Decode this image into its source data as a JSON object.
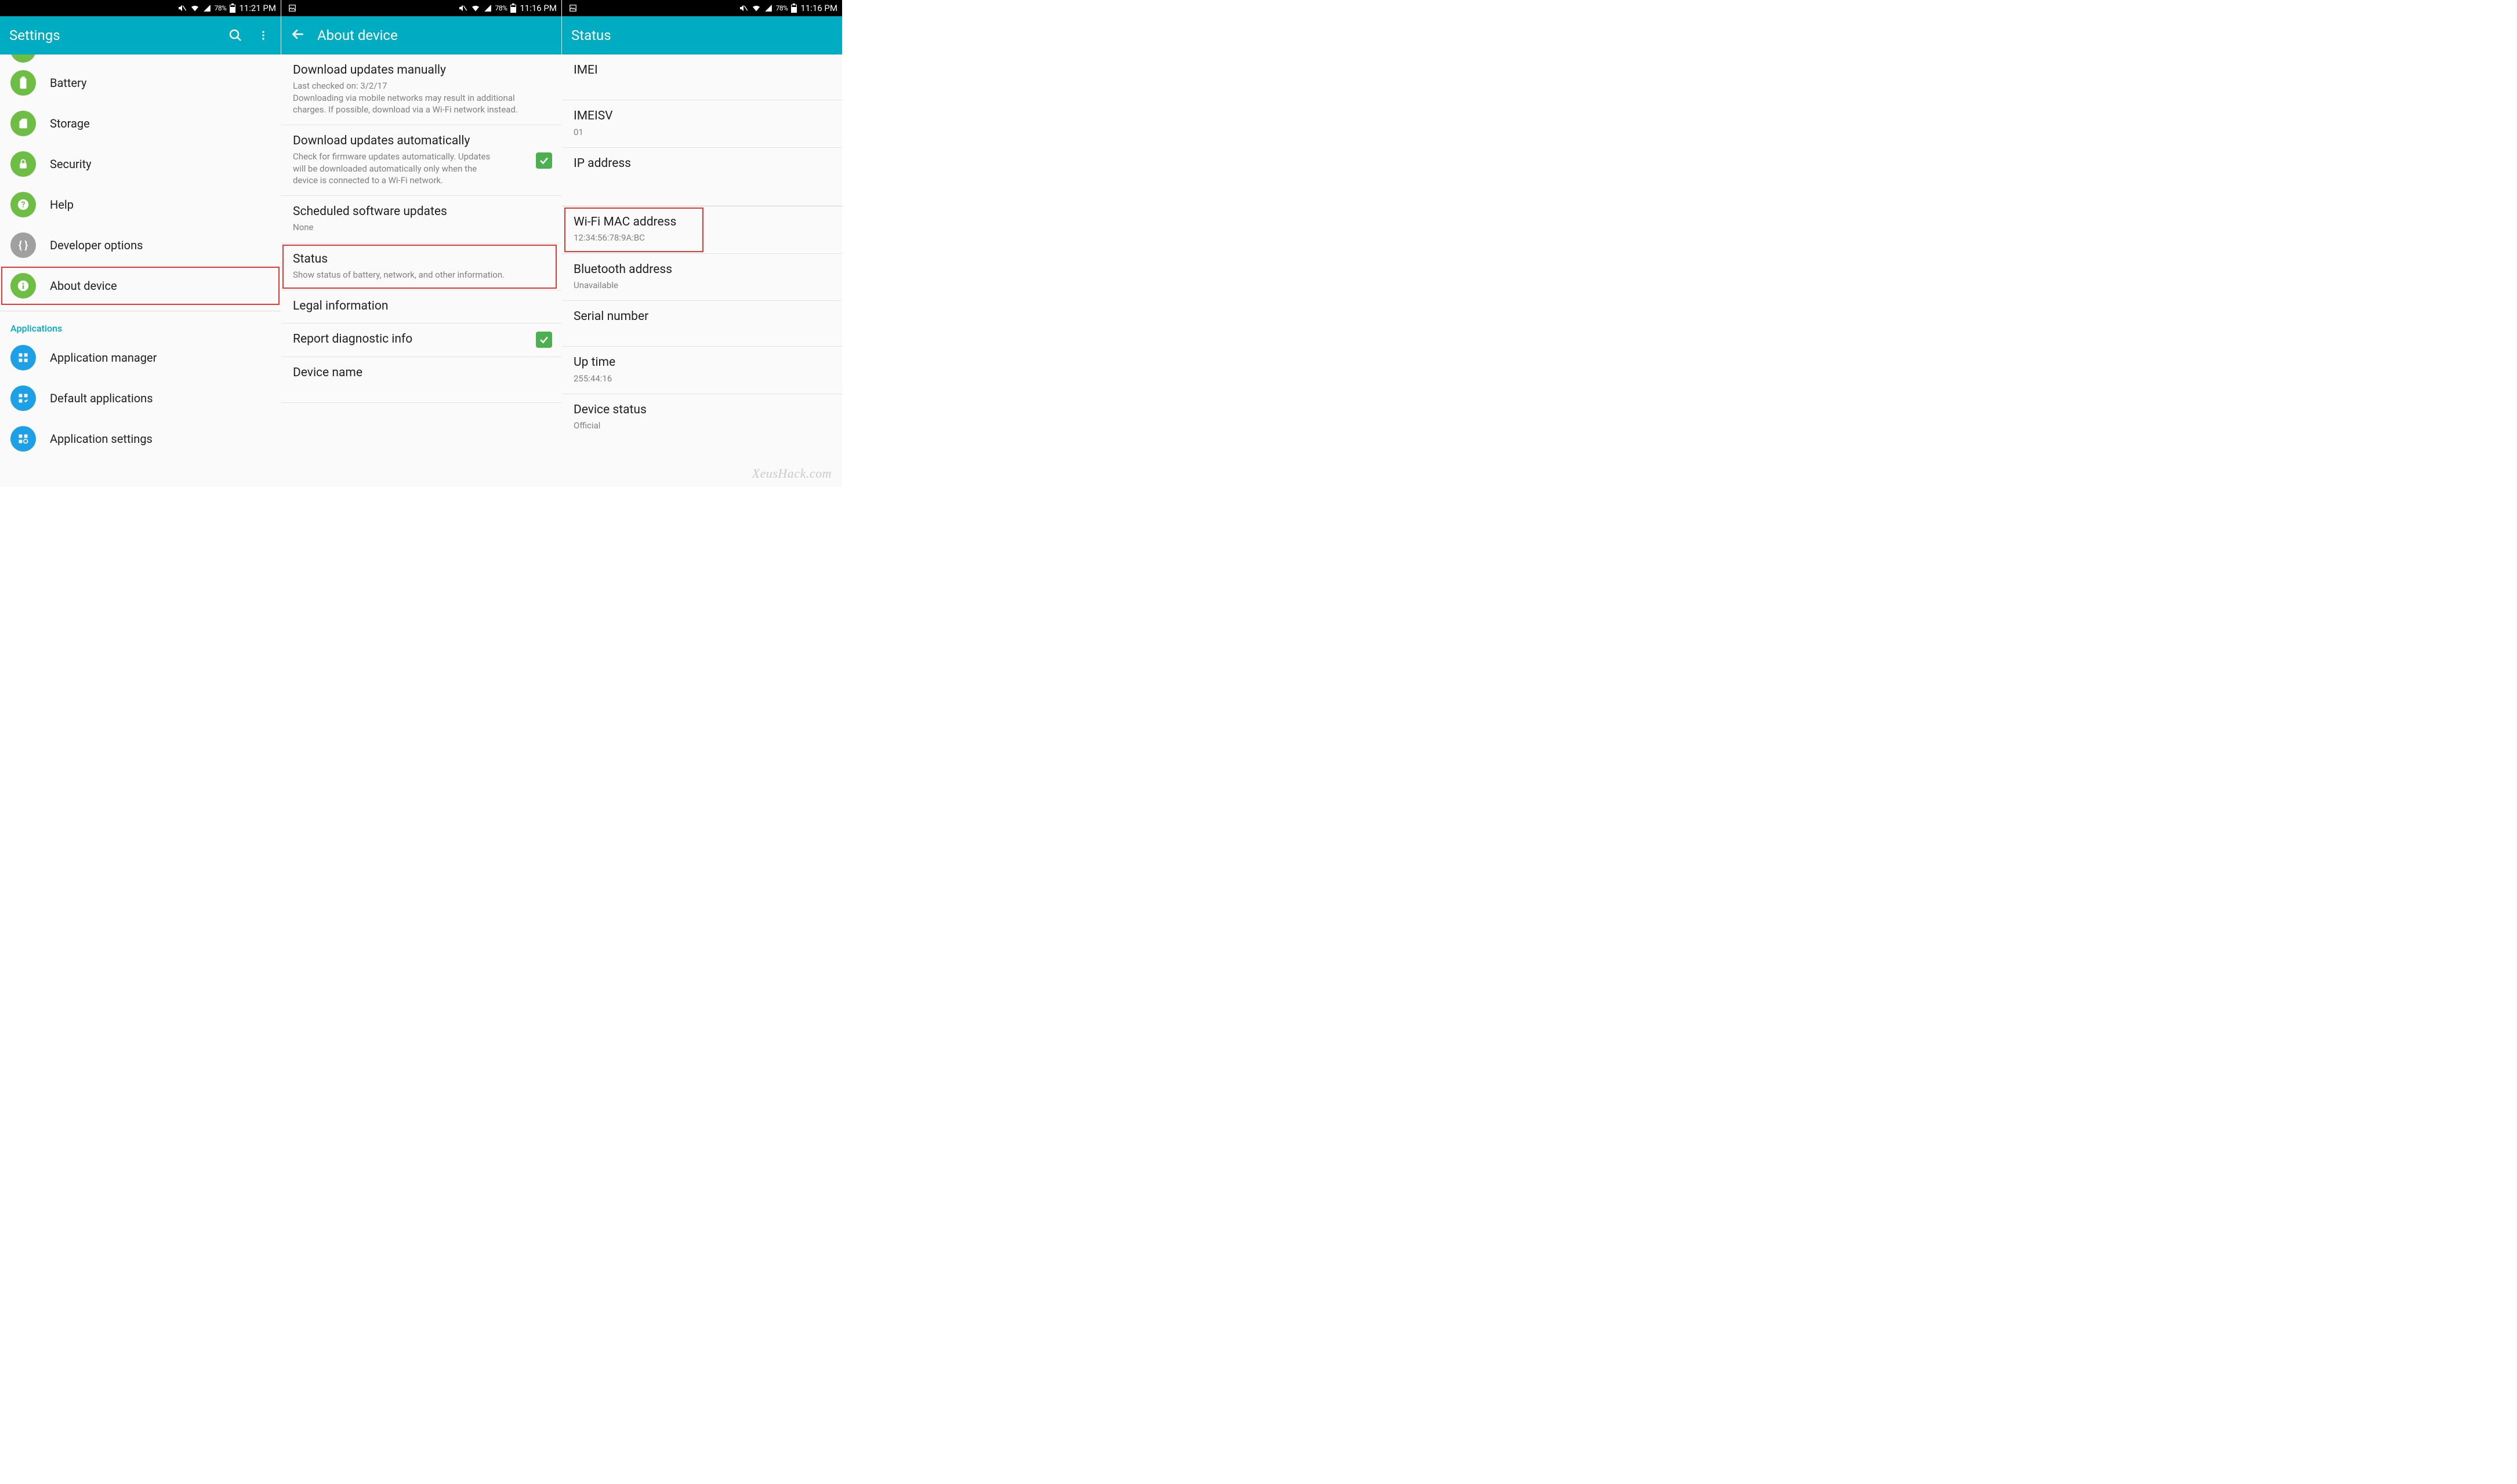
{
  "statusbar": {
    "battery_pct": "78%",
    "time1": "11:21 PM",
    "time2": "11:16 PM",
    "time3": "11:16 PM"
  },
  "panel1": {
    "title": "Settings",
    "items": {
      "battery": "Battery",
      "storage": "Storage",
      "security": "Security",
      "help": "Help",
      "devopts": "Developer options",
      "about": "About device"
    },
    "section_apps": "Applications",
    "apps": {
      "appmgr": "Application manager",
      "defaultapps": "Default applications",
      "appsettings": "Application settings"
    }
  },
  "panel2": {
    "title": "About device",
    "rows": {
      "dl_manual_title": "Download updates manually",
      "dl_manual_sub": "Last checked on: 3/2/17\nDownloading via mobile networks may result in additional charges. If possible, download via a Wi-Fi network instead.",
      "dl_auto_title": "Download updates automatically",
      "dl_auto_sub": "Check for firmware updates automatically. Updates will be downloaded automatically only when the device is connected to a Wi-Fi network.",
      "sched_title": "Scheduled software updates",
      "sched_sub": "None",
      "status_title": "Status",
      "status_sub": "Show status of battery, network, and other information.",
      "legal_title": "Legal information",
      "report_title": "Report diagnostic info",
      "devname_title": "Device name"
    }
  },
  "panel3": {
    "title": "Status",
    "rows": {
      "imei_title": "IMEI",
      "imeisv_title": "IMEISV",
      "imeisv_sub": "01",
      "ip_title": "IP address",
      "wifi_title": "Wi-Fi MAC address",
      "wifi_sub": "12:34:56:78:9A:BC",
      "bt_title": "Bluetooth address",
      "bt_sub": "Unavailable",
      "serial_title": "Serial number",
      "uptime_title": "Up time",
      "uptime_sub": "255:44:16",
      "devstatus_title": "Device status",
      "devstatus_sub": "Official"
    }
  },
  "watermark": "XeusHack.com"
}
